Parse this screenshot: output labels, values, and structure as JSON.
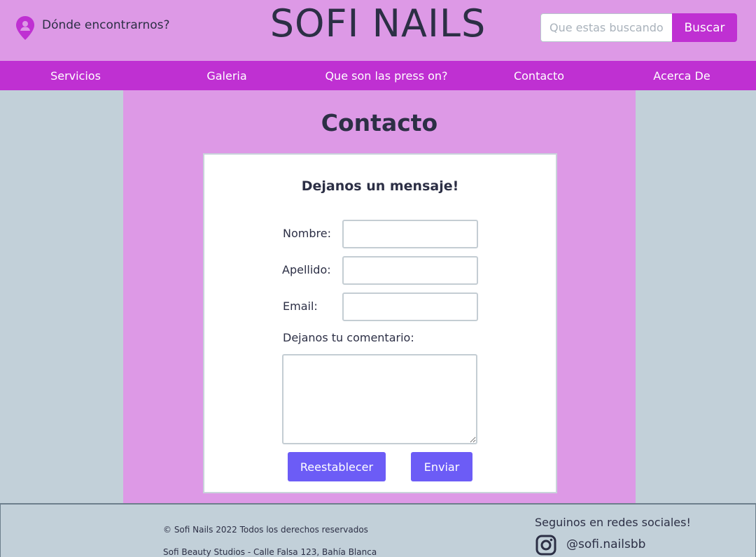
{
  "header": {
    "location_label": "Dónde encontrarnos?",
    "brand": "SOFI NAILS",
    "search_placeholder": "Que estas buscando?",
    "search_button": "Buscar"
  },
  "nav": {
    "items": [
      {
        "label": "Servicios"
      },
      {
        "label": "Galeria"
      },
      {
        "label": "Que son las press on?"
      },
      {
        "label": "Contacto"
      },
      {
        "label": "Acerca De"
      }
    ]
  },
  "main": {
    "title": "Contacto",
    "form": {
      "heading": "Dejanos un mensaje!",
      "nombre_label": "Nombre:",
      "apellido_label": "Apellido:",
      "email_label": "Email:",
      "comment_label": "Dejanos tu comentario:",
      "reset_button": "Reestablecer",
      "submit_button": "Enviar"
    }
  },
  "footer": {
    "copyright": "© Sofi Nails 2022 Todos los derechos reservados",
    "address": "Sofi Beauty Studios - Calle Falsa 123, Bahía Blanca",
    "social_title": "Seguinos en redes sociales!",
    "instagram_handle": "@sofi.nailsbb"
  },
  "colors": {
    "header_bg": "#dd99e6",
    "nav_bg": "#bf30d2",
    "button_accent": "#6c5cf6",
    "page_bg": "#c2d0d9",
    "text": "#2c2f45"
  }
}
